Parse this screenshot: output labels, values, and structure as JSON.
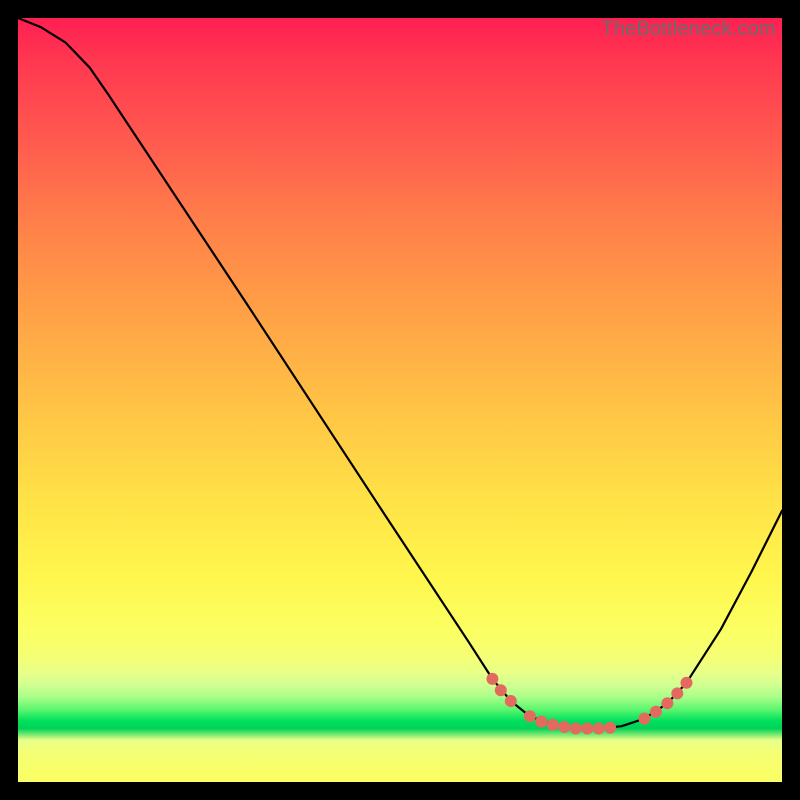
{
  "watermark": "TheBottleneck.com",
  "chart_data": {
    "type": "line",
    "title": "",
    "xlabel": "",
    "ylabel": "",
    "xlim": [
      0,
      100
    ],
    "ylim": [
      0,
      100
    ],
    "grid": false,
    "legend": false,
    "series": [
      {
        "name": "bottleneck-curve",
        "path": [
          {
            "x": 0.0,
            "y": 100.0
          },
          {
            "x": 3.0,
            "y": 98.8
          },
          {
            "x": 6.2,
            "y": 96.8
          },
          {
            "x": 9.4,
            "y": 93.5
          },
          {
            "x": 11.8,
            "y": 90.0
          },
          {
            "x": 30.0,
            "y": 62.5
          },
          {
            "x": 48.0,
            "y": 35.0
          },
          {
            "x": 59.0,
            "y": 18.3
          },
          {
            "x": 62.1,
            "y": 13.5
          },
          {
            "x": 64.5,
            "y": 10.6
          },
          {
            "x": 67.0,
            "y": 8.6
          },
          {
            "x": 70.0,
            "y": 7.5
          },
          {
            "x": 73.0,
            "y": 7.0
          },
          {
            "x": 76.0,
            "y": 7.0
          },
          {
            "x": 79.0,
            "y": 7.3
          },
          {
            "x": 82.0,
            "y": 8.3
          },
          {
            "x": 85.0,
            "y": 10.3
          },
          {
            "x": 87.5,
            "y": 13.0
          },
          {
            "x": 92.0,
            "y": 20.0
          },
          {
            "x": 96.0,
            "y": 27.5
          },
          {
            "x": 100.0,
            "y": 35.5
          }
        ]
      },
      {
        "name": "highlight-dots",
        "color": "#e36a5e",
        "points": [
          {
            "x": 62.1,
            "y": 13.5
          },
          {
            "x": 63.2,
            "y": 12.0
          },
          {
            "x": 64.5,
            "y": 10.6
          },
          {
            "x": 67.0,
            "y": 8.6
          },
          {
            "x": 68.5,
            "y": 7.9
          },
          {
            "x": 70.0,
            "y": 7.5
          },
          {
            "x": 71.5,
            "y": 7.2
          },
          {
            "x": 73.0,
            "y": 7.0
          },
          {
            "x": 74.5,
            "y": 7.0
          },
          {
            "x": 76.0,
            "y": 7.0
          },
          {
            "x": 77.5,
            "y": 7.1
          },
          {
            "x": 82.0,
            "y": 8.3
          },
          {
            "x": 83.5,
            "y": 9.2
          },
          {
            "x": 85.0,
            "y": 10.3
          },
          {
            "x": 86.3,
            "y": 11.6
          },
          {
            "x": 87.5,
            "y": 13.0
          }
        ]
      }
    ]
  }
}
